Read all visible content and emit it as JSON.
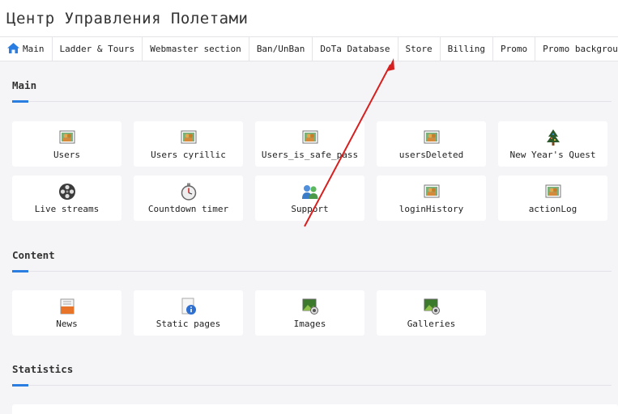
{
  "header": {
    "title": "Центр Управления Полетами"
  },
  "nav": {
    "items": [
      {
        "label": "Main",
        "icon": "home-icon"
      },
      {
        "label": "Ladder & Tours"
      },
      {
        "label": "Webmaster section"
      },
      {
        "label": "Ban/UnBan"
      },
      {
        "label": "DoTa Database"
      },
      {
        "label": "Store"
      },
      {
        "label": "Billing"
      },
      {
        "label": "Promo"
      },
      {
        "label": "Promo background"
      }
    ]
  },
  "sections": {
    "main": {
      "title": "Main",
      "tiles": [
        {
          "label": "Users",
          "icon": "users-icon"
        },
        {
          "label": "Users cyrillic",
          "icon": "users-icon"
        },
        {
          "label": "Users_is_safe_pass",
          "icon": "users-icon"
        },
        {
          "label": "usersDeleted",
          "icon": "users-icon"
        },
        {
          "label": "New Year's Quest",
          "icon": "christmas-tree-icon"
        },
        {
          "label": "Live streams",
          "icon": "film-reel-icon"
        },
        {
          "label": "Countdown timer",
          "icon": "stopwatch-icon"
        },
        {
          "label": "Support",
          "icon": "support-people-icon"
        },
        {
          "label": "loginHistory",
          "icon": "users-icon"
        },
        {
          "label": "actionLog",
          "icon": "users-icon"
        }
      ]
    },
    "content": {
      "title": "Content",
      "tiles": [
        {
          "label": "News",
          "icon": "news-icon"
        },
        {
          "label": "Static pages",
          "icon": "info-page-icon"
        },
        {
          "label": "Images",
          "icon": "image-icon"
        },
        {
          "label": "Galleries",
          "icon": "gallery-icon"
        }
      ]
    },
    "statistics": {
      "title": "Statistics"
    }
  },
  "colors": {
    "accent": "#2a7de1",
    "annotation": "#d62020"
  }
}
